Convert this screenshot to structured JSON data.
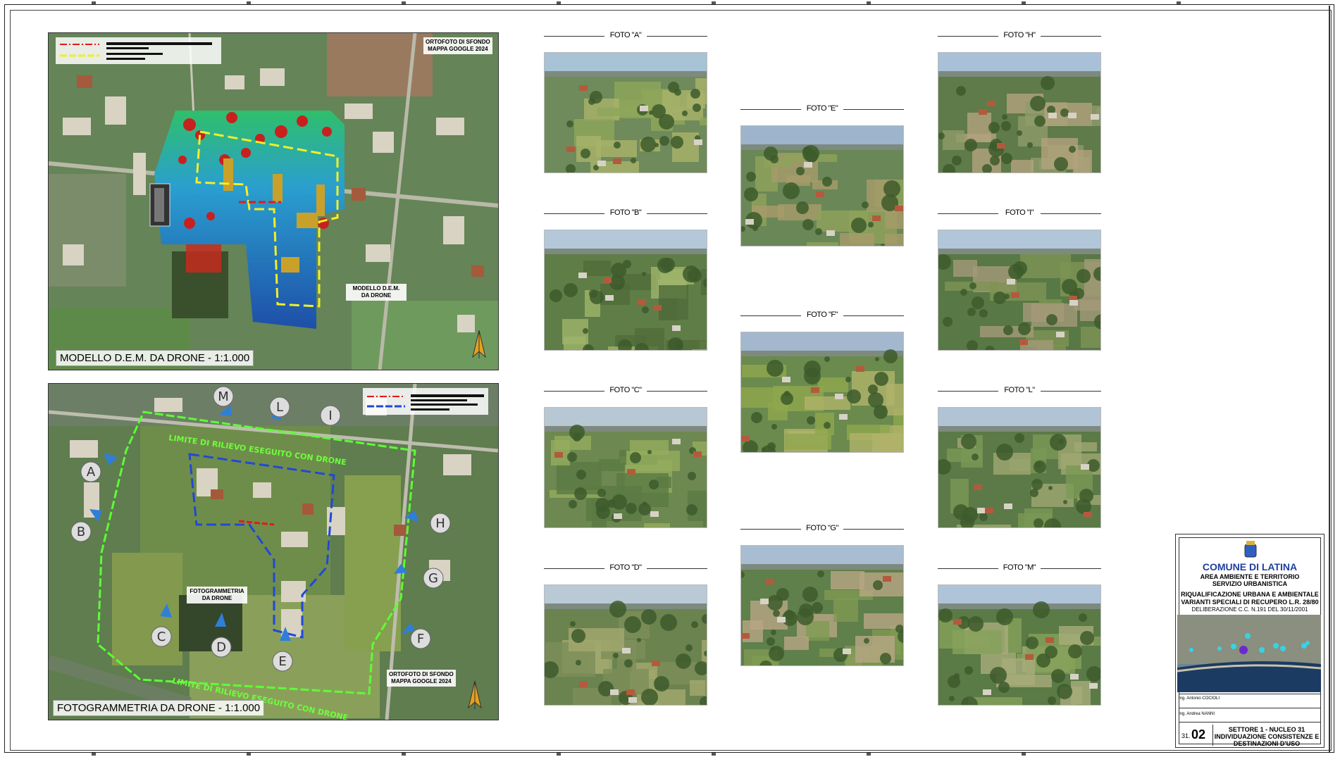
{
  "maps": {
    "dem": {
      "title": "MODELLO D.E.M. DA DRONE - 1:1.000",
      "bg_note": "ORTOFOTO DI SFONDO\nMAPPA GOOGLE 2024",
      "inset_note": "MODELLO D.E.M.\nDA DRONE",
      "scale_label": "DEM"
    },
    "photo": {
      "title": "FOTOGRAMMETRIA DA DRONE - 1:1.000",
      "bg_note": "ORTOFOTO DI SFONDO\nMAPPA GOOGLE 2024",
      "inset_note": "FOTOGRAMMETRIA\nDA DRONE",
      "limit_text": "LIMITE DI RILIEVO ESEGUITO CON DRONE",
      "markers": [
        "A",
        "B",
        "C",
        "D",
        "E",
        "G",
        "H",
        "I",
        "L",
        "M",
        "F"
      ]
    }
  },
  "photos": {
    "A": "FOTO \"A\"",
    "B": "FOTO \"B\"",
    "C": "FOTO \"C\"",
    "D": "FOTO \"D\"",
    "E": "FOTO \"E\"",
    "F": "FOTO \"F\"",
    "G": "FOTO \"G\"",
    "H": "FOTO \"H\"",
    "I": "FOTO \"I\"",
    "L": "FOTO \"L\"",
    "M": "FOTO \"M\""
  },
  "title_block": {
    "comune": "COMUNE DI LATINA",
    "area": "AREA AMBIENTE E TERRITORIO",
    "servizio": "SERVIZIO URBANISTICA",
    "project1": "RIQUALIFICAZIONE URBANA E AMBIENTALE",
    "project2": "VARIANTI SPECIALI DI RECUPERO L.R. 28/80",
    "delibera": "DELIBERAZIONE C.C. N.191 DEL 30/11/2001",
    "sign1": "Ing. Antonio COCIOLI",
    "sign2": "Ing. Andrea NANNI",
    "sheet_prefix": "31.",
    "sheet_num": "02",
    "desc1": "SETTORE 1 - NUCLEO 31",
    "desc2": "INDIVIDUAZIONE CONSISTENZE E",
    "desc3": "DESTINAZIONI D'USO"
  }
}
